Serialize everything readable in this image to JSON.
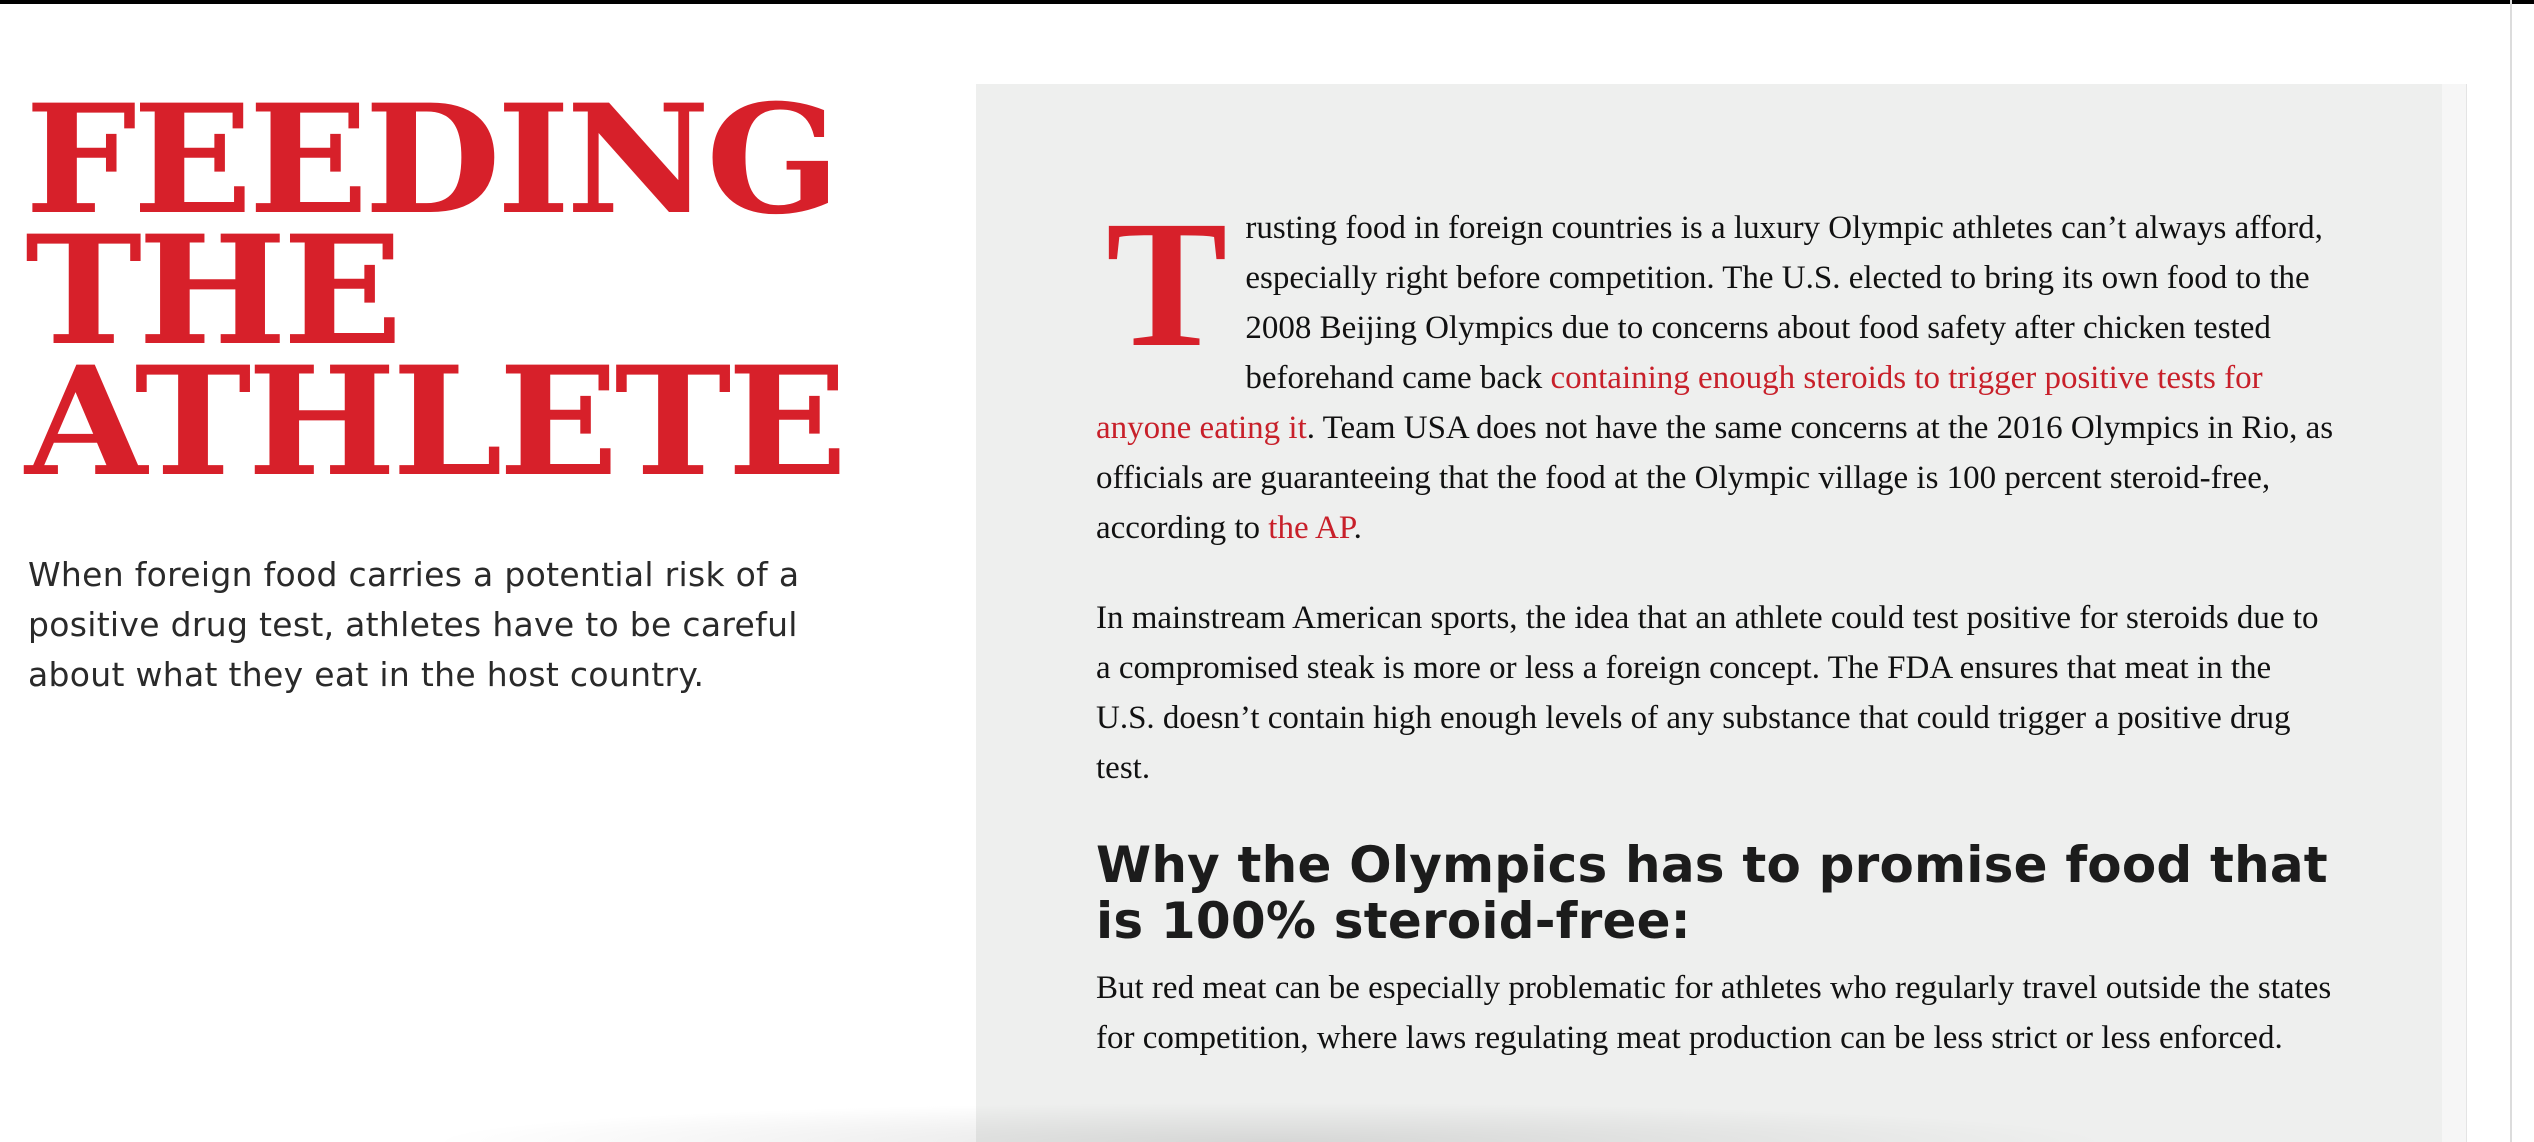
{
  "headline": {
    "line1": "FEEDING",
    "line2": "THE",
    "line3": "ATHLETE"
  },
  "dek": "When foreign food carries a potential risk of a positive drug test, athletes have to be careful about what they eat in the host country.",
  "article": {
    "p1": {
      "dropcap": "T",
      "text_before_link": "rusting food in foreign countries is a luxury Olympic athletes can’t always afford, especially right before competition. The U.S. elected to bring its own food to the 2008 Beijing Olympics due to concerns about food safety after chicken tested beforehand came back ",
      "link1": "containing enough steroids to trigger positive tests for anyone eating it",
      "text_middle": ". Team USA does not have the same concerns at the 2016 Olympics in Rio, as officials are guaranteeing that the food at the Olympic village is 100 percent steroid-free, according to ",
      "link2": "the AP",
      "text_end": "."
    },
    "p2": "In mainstream American sports, the idea that an athlete could test positive for steroids due to a compromised steak is more or less a foreign concept. The FDA ensures that meat in the U.S. doesn’t contain high enough levels of any substance that could trigger a positive drug test.",
    "subhead": "Why the Olympics has to promise food that is 100% steroid-free:",
    "p3": "But red meat can be especially problematic for athletes who regularly travel outside the states for competition, where laws regulating meat production can be less strict or less enforced."
  },
  "colors": {
    "accent_red": "#d7202a",
    "card_bg": "#eeefee",
    "body_text": "#111111"
  }
}
